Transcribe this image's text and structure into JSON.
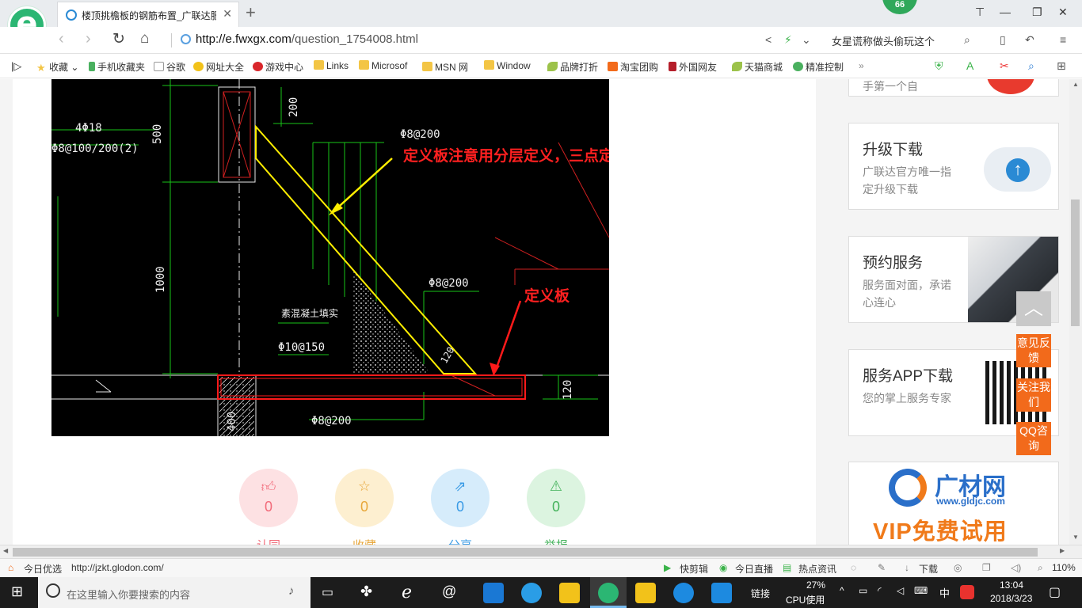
{
  "browser": {
    "tab_title": "楼顶挑檐板的钢筋布置_广联达服",
    "badge": "66",
    "url_host": "http://e.fwxgx.com",
    "url_path": "/question_1754008.html",
    "search_hint": "女星谎称做头偷玩这个"
  },
  "bookmarks": [
    {
      "label": "收藏",
      "icon": "star-icon"
    },
    {
      "label": "手机收藏夹",
      "icon": "phone-icon"
    },
    {
      "label": "谷歌",
      "icon": "page-icon"
    },
    {
      "label": "网址大全",
      "icon": "globe-icon"
    },
    {
      "label": "游戏中心",
      "icon": "game-icon"
    },
    {
      "label": "Links",
      "icon": "folder-icon"
    },
    {
      "label": "Microsof",
      "icon": "folder-icon"
    },
    {
      "label": "MSN 网",
      "icon": "folder-icon"
    },
    {
      "label": "Window",
      "icon": "folder-icon"
    },
    {
      "label": "品牌打折",
      "icon": "leaf-icon"
    },
    {
      "label": "淘宝团购",
      "icon": "taobao-icon"
    },
    {
      "label": "外国网友",
      "icon": "flag-icon"
    },
    {
      "label": "天猫商城",
      "icon": "leaf-icon"
    },
    {
      "label": "精准控制",
      "icon": "chat-icon"
    }
  ],
  "drawing": {
    "labels": {
      "rebar_4": "4Φ18",
      "stirrup": "Φ8@100/200(2)",
      "dim_500": "500",
      "dim_200": "200",
      "dim_1000": "1000",
      "phi8_top": "Φ8@200",
      "phi8_mid": "Φ8@200",
      "phi8_bottom": "Φ8@200",
      "concrete_fill": "素混凝土填实",
      "phi10": "Φ10@150",
      "dim_120a": "120",
      "dim_120b": "120",
      "dim_400": "400"
    },
    "annotation_slope": "定义板注意用分层定义，三点定义斜板",
    "annotation_slab": "定义板",
    "annotation_color": "#ff2020",
    "highlight_yellow": "#ffee00",
    "highlight_red": "#ff1a1a"
  },
  "actions": [
    {
      "count": "0",
      "label": "认同",
      "icon": "thumbs-up-icon",
      "bg": "#fde1e3",
      "color": "#f26b7a"
    },
    {
      "count": "0",
      "label": "收藏",
      "icon": "star-icon",
      "bg": "#fdefd0",
      "color": "#e8a73a"
    },
    {
      "count": "0",
      "label": "分享",
      "icon": "share-icon",
      "bg": "#d6ecfb",
      "color": "#3a9be6"
    },
    {
      "count": "0",
      "label": "举报",
      "icon": "warning-icon",
      "bg": "#dcf4e0",
      "color": "#45b35c"
    }
  ],
  "sidebar": {
    "top_partial": "手第一个自",
    "upgrade": {
      "title": "升级下载",
      "sub": "广联达官方唯一指定升级下载"
    },
    "booking": {
      "title": "预约服务",
      "sub": "服务面对面，承诺心连心"
    },
    "app": {
      "title": "服务APP下载",
      "sub": "您的掌上服务专家"
    },
    "ad": {
      "brand": "广材网",
      "site": "www.gldjc.com",
      "promo": "VIP免费试用"
    }
  },
  "float_buttons": [
    "意见反馈",
    "关注我们",
    "QQ咨询"
  ],
  "status": {
    "left": "今日优选",
    "url": "http://jzkt.glodon.com/",
    "items": [
      "快剪辑",
      "今日直播",
      "热点资讯",
      "下载"
    ],
    "zoom": "110%"
  },
  "taskbar": {
    "search_placeholder": "在这里输入你要搜索的内容",
    "link": "链接",
    "cpu_pct": "27%",
    "cpu_label": "CPU使用",
    "ime": "中",
    "time": "13:04",
    "date": "2018/3/23"
  }
}
